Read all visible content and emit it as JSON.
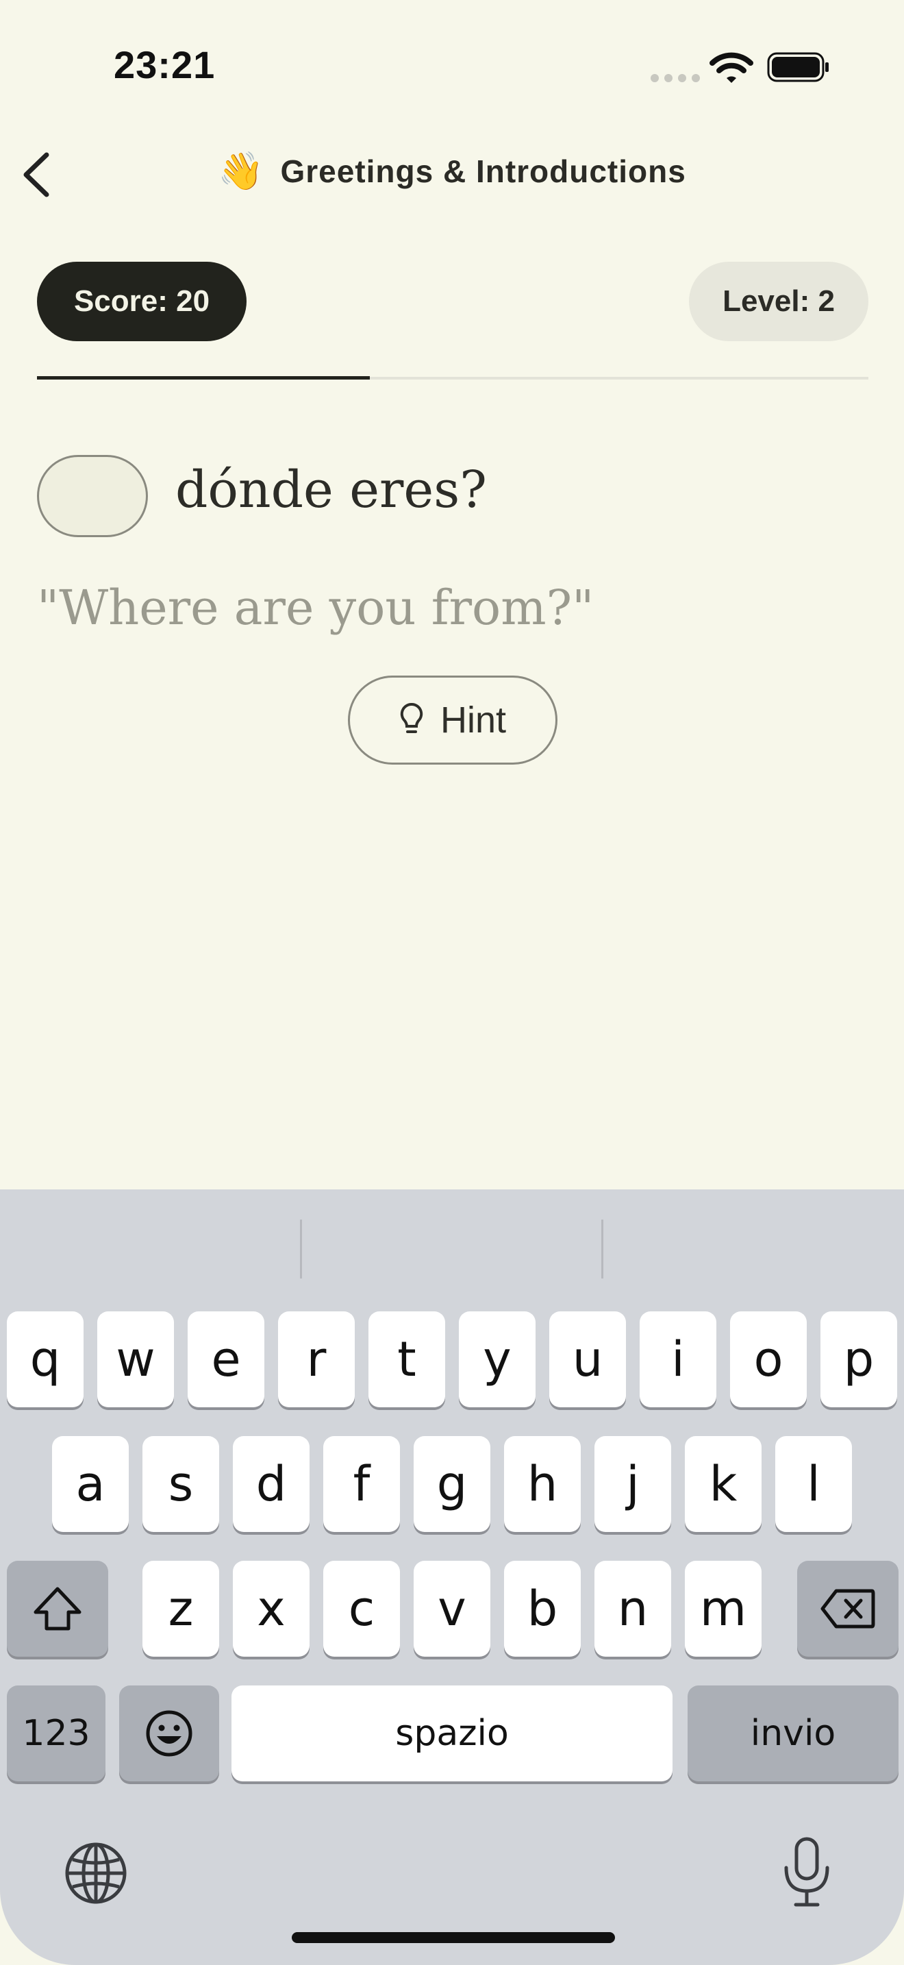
{
  "status_bar": {
    "time": "23:21"
  },
  "nav": {
    "emoji": "👋",
    "title": "Greetings & Introductions"
  },
  "score": {
    "label": "Score: 20"
  },
  "level": {
    "label": "Level: 2"
  },
  "progress": {
    "fraction": 0.4
  },
  "exercise": {
    "answer_value": "",
    "prompt_suffix": "dónde eres?",
    "translation": "\"Where are you from?\"",
    "hint_label": "Hint"
  },
  "keyboard": {
    "row1": [
      "q",
      "w",
      "e",
      "r",
      "t",
      "y",
      "u",
      "i",
      "o",
      "p"
    ],
    "row2": [
      "a",
      "s",
      "d",
      "f",
      "g",
      "h",
      "j",
      "k",
      "l"
    ],
    "row3": [
      "z",
      "x",
      "c",
      "v",
      "b",
      "n",
      "m"
    ],
    "numbers_label": "123",
    "space_label": "spazio",
    "return_label": "invio"
  },
  "colors": {
    "background": "#f7f7ea",
    "accent_dark": "#22231d",
    "keyboard_bg": "#d2d5da"
  }
}
